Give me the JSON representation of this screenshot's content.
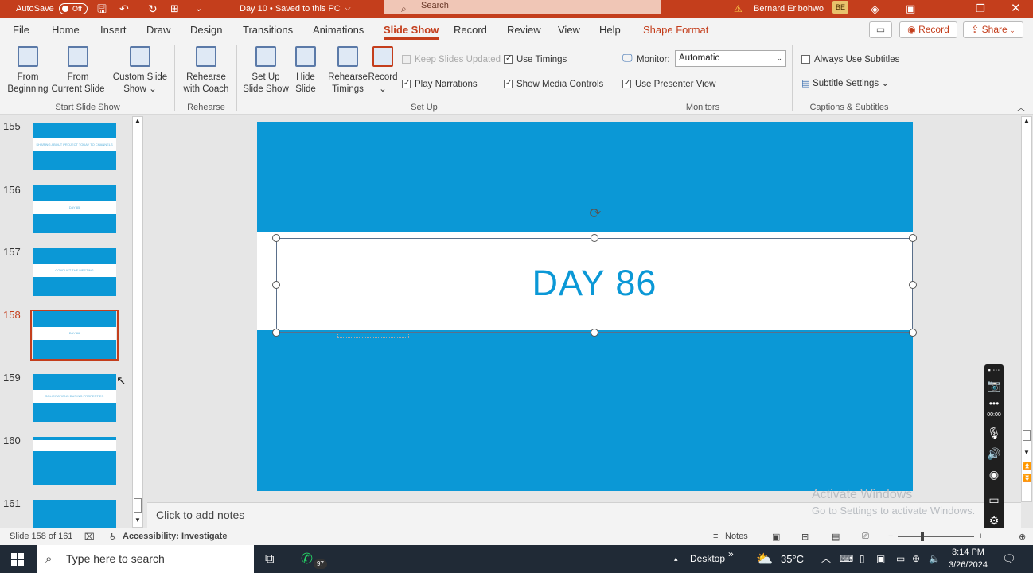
{
  "titlebar": {
    "autosave": "AutoSave",
    "autosave_state": "Off",
    "document": "Day 10 • Saved to this PC",
    "search_placeholder": "Search",
    "user": "Bernard Eribohwo",
    "initials": "BE"
  },
  "tabs": [
    "File",
    "Home",
    "Insert",
    "Draw",
    "Design",
    "Transitions",
    "Animations",
    "Slide Show",
    "Record",
    "Review",
    "View",
    "Help",
    "Shape Format"
  ],
  "active_tab": "Slide Show",
  "header_buttons": {
    "record": "Record",
    "share": "Share"
  },
  "ribbon": {
    "from_beginning": [
      "From",
      "Beginning"
    ],
    "from_current": [
      "From",
      "Current Slide"
    ],
    "custom_show": [
      "Custom Slide",
      "Show"
    ],
    "group_start": "Start Slide Show",
    "rehearse_coach": [
      "Rehearse",
      "with Coach"
    ],
    "group_rehearse": "Rehearse",
    "setup_show": [
      "Set Up",
      "Slide Show"
    ],
    "hide_slide": [
      "Hide",
      "Slide"
    ],
    "rehearse_timings": [
      "Rehearse",
      "Timings"
    ],
    "record": "Record",
    "keep_updated": "Keep Slides Updated",
    "use_timings": "Use Timings",
    "play_narrations": "Play Narrations",
    "show_media": "Show Media Controls",
    "group_setup": "Set Up",
    "monitor_label": "Monitor:",
    "monitor_value": "Automatic",
    "presenter_view": "Use Presenter View",
    "group_monitors": "Monitors",
    "always_subtitles": "Always Use Subtitles",
    "subtitle_settings": "Subtitle Settings",
    "group_captions": "Captions & Subtitles"
  },
  "thumbnails": [
    {
      "num": "155",
      "text": "SHARING ABOUT PROJECT TODAY TO CHANNELS"
    },
    {
      "num": "156",
      "text": "DAY 85"
    },
    {
      "num": "157",
      "text": "CONDUCT THE MEETING"
    },
    {
      "num": "158",
      "text": "DAY 86"
    },
    {
      "num": "159",
      "text": "SOLICITATIONS DURING PROPERTIES"
    },
    {
      "num": "160",
      "text": ""
    },
    {
      "num": "161",
      "text": ""
    }
  ],
  "slide": {
    "title": "DAY 86"
  },
  "notes_placeholder": "Click to add notes",
  "watermark": {
    "line1": "Activate Windows",
    "line2": "Go to Settings to activate Windows."
  },
  "status": {
    "slide_count": "Slide 158 of 161",
    "accessibility": "Accessibility: Investigate",
    "notes": "Notes"
  },
  "taskbar": {
    "search": "Type here to search",
    "whatsapp_badge": "97",
    "desktop": "Desktop",
    "weather": "35°C",
    "time": "3:14 PM",
    "date": "3/26/2024"
  }
}
